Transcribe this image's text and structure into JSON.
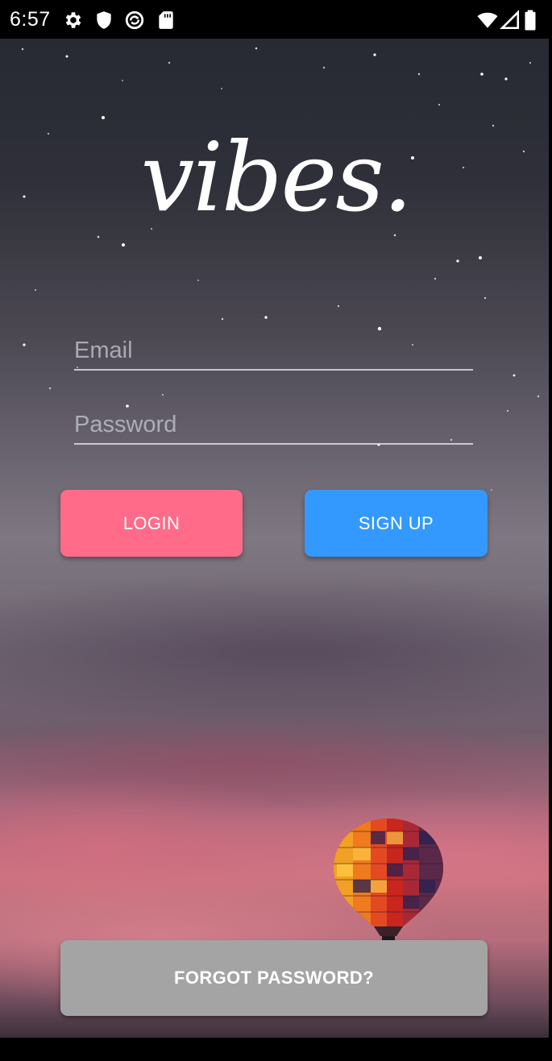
{
  "status_bar": {
    "time": "6:57",
    "icons": [
      "gear-icon",
      "shield-icon",
      "sync-circle-icon",
      "sd-card-icon",
      "wifi-icon",
      "signal-icon",
      "battery-icon"
    ]
  },
  "app": {
    "logo_text": "vibes."
  },
  "login_form": {
    "email_placeholder": "Email",
    "email_value": "",
    "password_placeholder": "Password",
    "password_value": "",
    "login_label": "LOGIN",
    "signup_label": "SIGN UP",
    "forgot_label": "FORGOT PASSWORD?"
  },
  "colors": {
    "login_button": "#ff6b89",
    "signup_button": "#3399ff",
    "forgot_button": "#a4a4a4",
    "status_bar": "#000000"
  }
}
